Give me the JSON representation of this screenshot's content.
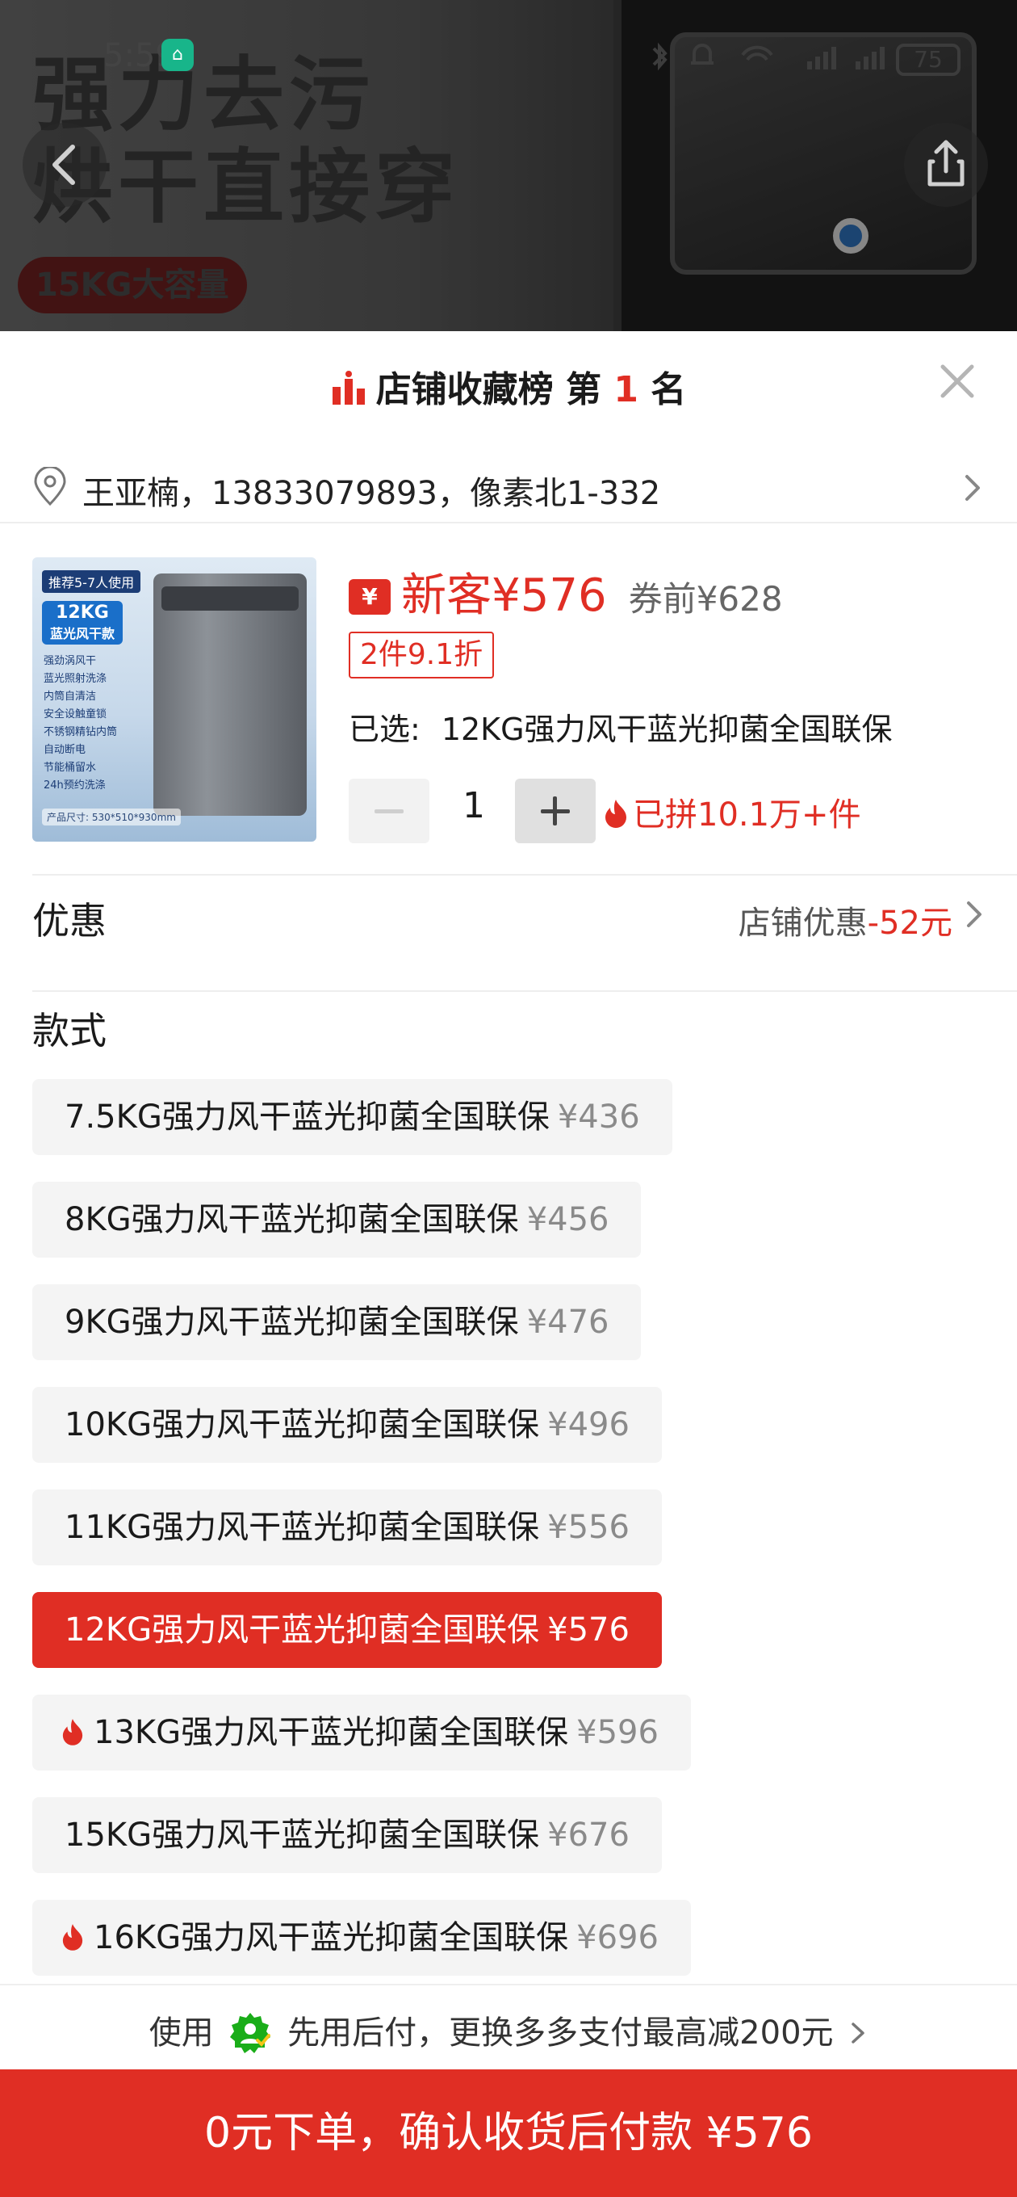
{
  "status_bar": {
    "time": "5:59",
    "battery": "75"
  },
  "hero": {
    "line1": "强力去污",
    "line2": "烘干直接穿",
    "badge": "15KG大容量"
  },
  "ranking": {
    "prefix": "店铺收藏榜 第",
    "rank": "1",
    "suffix": "名"
  },
  "address": {
    "text": "王亚楠，13833079893，像素北1-332"
  },
  "product": {
    "thumbnail": {
      "tag": "推荐5-7人使用",
      "capacity_line1": "12KG",
      "capacity_line2": "蓝光风干款",
      "features": [
        "强劲涡风干",
        "蓝光照射洗涤",
        "内筒自清洁",
        "安全设触童锁",
        "不锈钢精钻内筒",
        "自动断电",
        "节能桶留水",
        "24h预约洗涤"
      ],
      "dims": "产品尺寸: 530*510*930mm"
    },
    "price_badge": "¥",
    "price_label": "新客¥576",
    "original_price": "券前¥628",
    "discount": "2件9.1折",
    "selected_label": "已选:",
    "selected_value": "12KG强力风干蓝光抑菌全国联保",
    "quantity": "1",
    "sold": "已拼10.1万+件"
  },
  "promotion": {
    "title": "优惠",
    "label": "店铺优惠",
    "amount": "-52元"
  },
  "styles": {
    "title": "款式",
    "options": [
      {
        "name": "7.5KG强力风干蓝光抑菌全国联保",
        "price": "¥436",
        "selected": false,
        "hot": false
      },
      {
        "name": "8KG强力风干蓝光抑菌全国联保",
        "price": "¥456",
        "selected": false,
        "hot": false
      },
      {
        "name": "9KG强力风干蓝光抑菌全国联保",
        "price": "¥476",
        "selected": false,
        "hot": false
      },
      {
        "name": "10KG强力风干蓝光抑菌全国联保",
        "price": "¥496",
        "selected": false,
        "hot": false
      },
      {
        "name": "11KG强力风干蓝光抑菌全国联保",
        "price": "¥556",
        "selected": false,
        "hot": false
      },
      {
        "name": "12KG强力风干蓝光抑菌全国联保",
        "price": "¥576",
        "selected": true,
        "hot": false
      },
      {
        "name": "13KG强力风干蓝光抑菌全国联保",
        "price": "¥596",
        "selected": false,
        "hot": true
      },
      {
        "name": "15KG强力风干蓝光抑菌全国联保",
        "price": "¥676",
        "selected": false,
        "hot": false
      },
      {
        "name": "16KG强力风干蓝光抑菌全国联保",
        "price": "¥696",
        "selected": false,
        "hot": true
      }
    ]
  },
  "pay_later": {
    "prefix": "使用",
    "text": "先用后付，更换多多支付最高减200元"
  },
  "confirm_button": {
    "label": "0元下单，确认收货后付款 ¥576"
  },
  "colors": {
    "accent": "#e02e24",
    "option_bg": "#f4f4f4",
    "muted_price": "#8a8a8a",
    "paylater_green": "#1aad19"
  }
}
